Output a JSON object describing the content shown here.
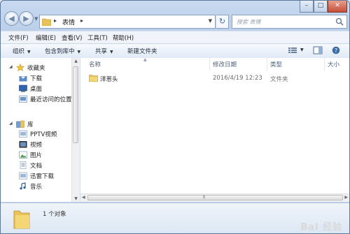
{
  "nav": {
    "breadcrumb": "表情",
    "search_placeholder": "搜索 表情"
  },
  "menu": [
    "文件(F)",
    "编辑(E)",
    "查看(V)",
    "工具(T)",
    "帮助(H)"
  ],
  "toolbar": {
    "organize": "组织",
    "include_library": "包含到库中",
    "share": "共享",
    "new_folder": "新建文件夹"
  },
  "sidebar": {
    "favorites": "收藏夹",
    "fav_items": [
      "下载",
      "桌面",
      "最近访问的位置"
    ],
    "library": "库",
    "lib_items": [
      "PPTV视频",
      "视频",
      "图片",
      "文档",
      "迅雷下载",
      "音乐"
    ]
  },
  "columns": {
    "name": "名称",
    "date": "修改日期",
    "type": "类型",
    "size": "大小"
  },
  "files": [
    {
      "name": "洋葱头",
      "date": "2016/4/19 12:23",
      "type": "文件夹"
    }
  ],
  "status": {
    "count": "1 个对象"
  },
  "watermark": "Bai 经验",
  "colors": {
    "folder": "#e8c25a",
    "accent": "#3a6ea5"
  }
}
